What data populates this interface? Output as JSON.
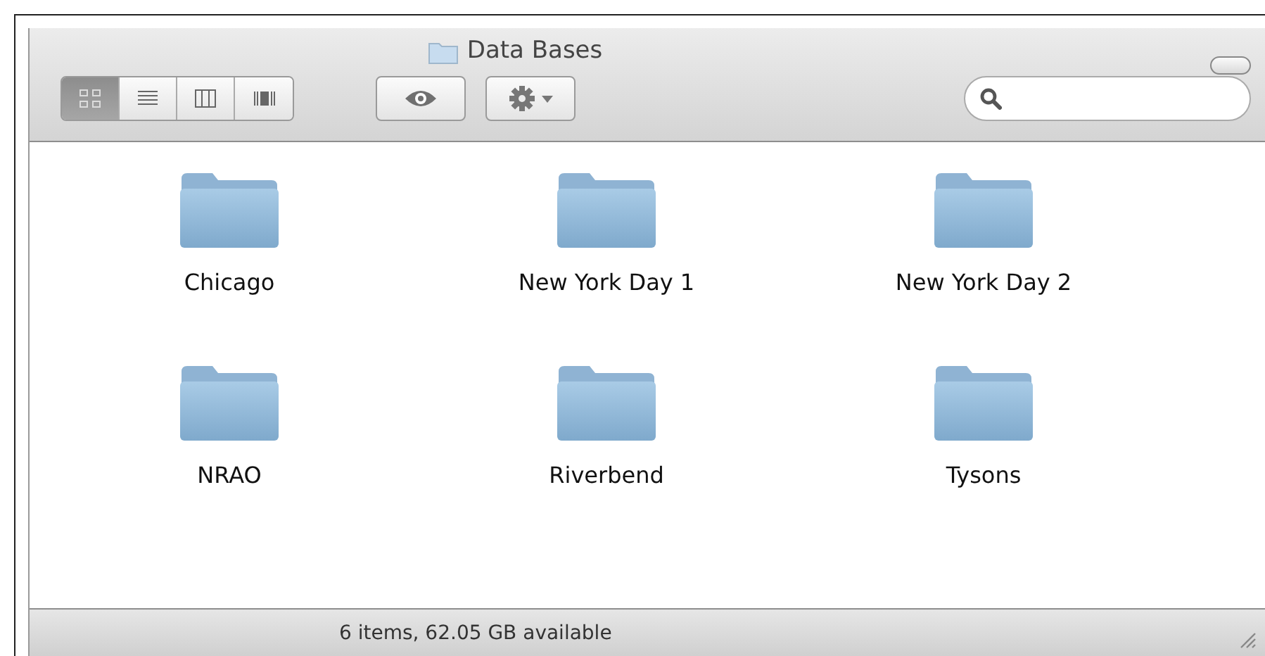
{
  "window": {
    "title": "Data Bases"
  },
  "view_buttons": [
    {
      "kind": "icons",
      "selected": true
    },
    {
      "kind": "list",
      "selected": false
    },
    {
      "kind": "columns",
      "selected": false
    },
    {
      "kind": "coverflow",
      "selected": false
    }
  ],
  "items": [
    {
      "name": "Chicago"
    },
    {
      "name": "New York Day 1"
    },
    {
      "name": "New York Day 2"
    },
    {
      "name": "NRAO"
    },
    {
      "name": "Riverbend"
    },
    {
      "name": "Tysons"
    }
  ],
  "status_bar": {
    "text": "6 items, 62.05 GB available"
  }
}
